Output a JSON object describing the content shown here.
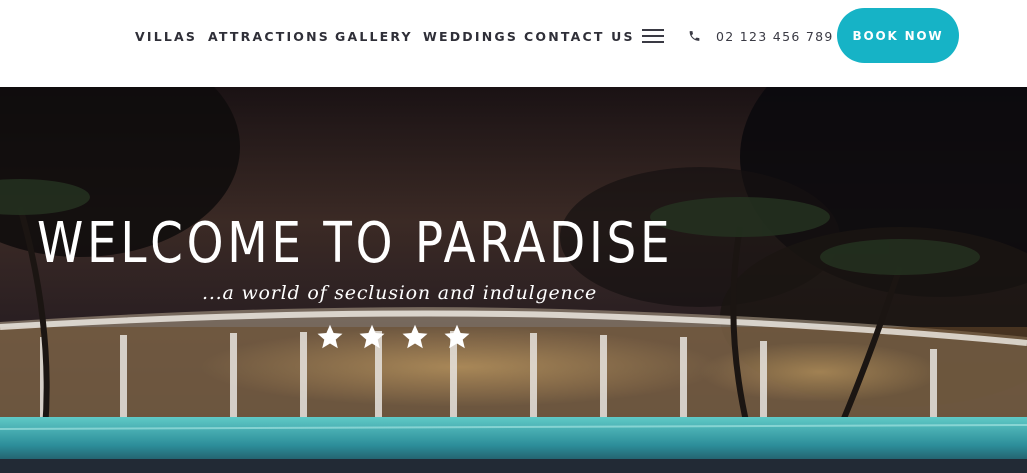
{
  "nav": {
    "links": [
      {
        "label": "VILLAS"
      },
      {
        "label": "ATTRACTIONS"
      },
      {
        "label": "GALLERY"
      },
      {
        "label": "WEDDINGS"
      },
      {
        "label": "CONTACT US"
      }
    ],
    "menu_icon": "hamburger-menu-icon",
    "phone_icon": "phone-icon",
    "phone_number": "02 123 456 789",
    "book_label": "BOOK NOW"
  },
  "hero": {
    "title": "WELCOME TO PARADISE",
    "subtitle": "...a world of seclusion and indulgence",
    "rating": 4,
    "star_icon": "star-icon"
  },
  "colors": {
    "accent": "#16b3c6",
    "nav_text": "#2f2f38",
    "hero_text": "#ffffff"
  }
}
